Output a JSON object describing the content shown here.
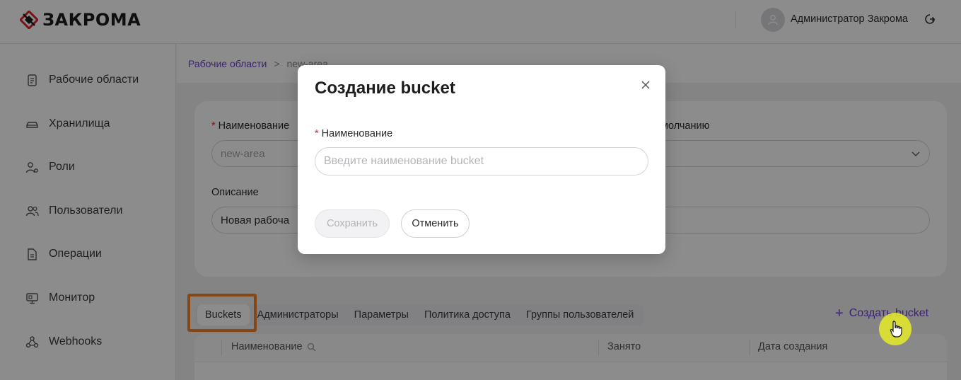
{
  "header": {
    "logo_text": "ЗАКРОМА",
    "user_name": "Администратор Закрома"
  },
  "sidebar": {
    "items": [
      {
        "label": "Рабочие области",
        "icon": "document-icon"
      },
      {
        "label": "Хранилища",
        "icon": "storage-icon"
      },
      {
        "label": "Роли",
        "icon": "user-role-icon"
      },
      {
        "label": "Пользователи",
        "icon": "users-icon"
      },
      {
        "label": "Операции",
        "icon": "operations-icon"
      },
      {
        "label": "Монитор",
        "icon": "monitor-icon"
      },
      {
        "label": "Webhooks",
        "icon": "webhooks-icon"
      }
    ]
  },
  "breadcrumb": {
    "link": "Рабочие области",
    "separator": ">",
    "current": "new-area"
  },
  "form": {
    "name_label": "Наименование",
    "name_value": "new-area",
    "default_label": "молчанию",
    "description_label": "Описание",
    "description_value": "Новая рабоча"
  },
  "tabs": [
    "Buckets",
    "Администраторы",
    "Параметры",
    "Политика доступа",
    "Группы пользователей"
  ],
  "create_button": {
    "label": "Создать bucket"
  },
  "table": {
    "columns": [
      "Наименование",
      "Занято",
      "Дата создания"
    ]
  },
  "modal": {
    "title": "Создание bucket",
    "name_label": "Наименование",
    "name_placeholder": "Введите наименование bucket",
    "save_label": "Сохранить",
    "cancel_label": "Отменить"
  },
  "colors": {
    "accent": "#6a3fc9",
    "highlight": "#f5822a",
    "required": "#e0282e"
  }
}
